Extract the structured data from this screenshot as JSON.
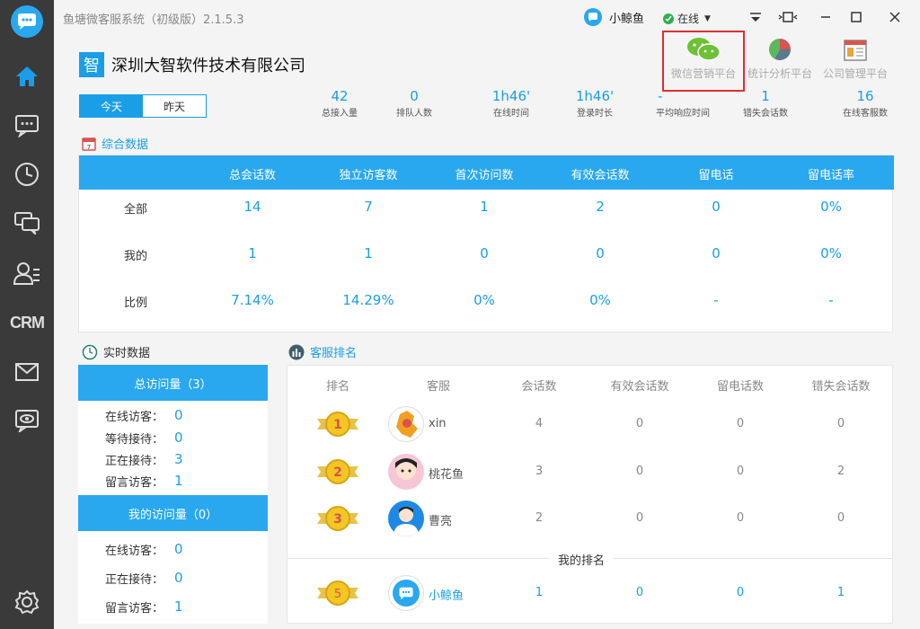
{
  "app": {
    "title": "鱼塘微客服系统（初级版）2.1.5.3",
    "user": "小鲸鱼",
    "status": "在线"
  },
  "sidebar": {
    "items": [
      "home-icon",
      "chat-icon",
      "history-icon",
      "dialog-icon",
      "contacts-icon",
      "CRM",
      "mail-icon",
      "monitor-icon",
      "settings-icon"
    ],
    "crm_label": "CRM"
  },
  "company": {
    "badge": "智",
    "name": "深圳大智软件技术有限公司"
  },
  "platforms": [
    {
      "label": "微信营销平台",
      "icon": "wechat-icon"
    },
    {
      "label": "统计分析平台",
      "icon": "pie-chart-icon"
    },
    {
      "label": "公司管理平台",
      "icon": "company-icon"
    }
  ],
  "day_tabs": [
    "今天",
    "昨天"
  ],
  "stats": [
    {
      "value": "42",
      "label": "总接入量"
    },
    {
      "value": "0",
      "label": "排队人数"
    },
    {
      "value": "1h46'",
      "label": "在线时间"
    },
    {
      "value": "1h46'",
      "label": "登录时长"
    },
    {
      "value": "-",
      "label": "平均响应时间"
    },
    {
      "value": "1",
      "label": "错失会话数"
    },
    {
      "value": "16",
      "label": "在线客服数"
    }
  ],
  "combined": {
    "title": "综合数据",
    "headers": [
      "总会话数",
      "独立访客数",
      "首次访问数",
      "有效会话数",
      "留电话",
      "留电话率"
    ],
    "rows": [
      {
        "label": "全部",
        "values": [
          "14",
          "7",
          "1",
          "2",
          "0",
          "0%"
        ]
      },
      {
        "label": "我的",
        "values": [
          "1",
          "1",
          "0",
          "0",
          "0",
          "0%"
        ]
      },
      {
        "label": "比例",
        "values": [
          "7.14%",
          "14.29%",
          "0%",
          "0%",
          "-",
          "-"
        ]
      }
    ]
  },
  "realtime": {
    "title": "实时数据",
    "total_bar": "总访问量（3）",
    "total_rows": [
      {
        "label": "在线访客：",
        "value": "0"
      },
      {
        "label": "等待接待：",
        "value": "0"
      },
      {
        "label": "正在接待：",
        "value": "3"
      },
      {
        "label": "留言访客：",
        "value": "1"
      }
    ],
    "mine_bar": "我的访问量（0）",
    "mine_rows": [
      {
        "label": "在线访客：",
        "value": "0"
      },
      {
        "label": "正在接待：",
        "value": "0"
      },
      {
        "label": "留言访客：",
        "value": "1"
      }
    ]
  },
  "ranking": {
    "title": "客服排名",
    "headers": [
      "排名",
      "客服",
      "会话数",
      "有效会话数",
      "留电话数",
      "错失会话数"
    ],
    "rows": [
      {
        "rank": "1",
        "name": "xin",
        "values": [
          "4",
          "0",
          "0",
          "0"
        ]
      },
      {
        "rank": "2",
        "name": "桃花鱼",
        "values": [
          "3",
          "0",
          "0",
          "2"
        ]
      },
      {
        "rank": "3",
        "name": "曹亮",
        "values": [
          "2",
          "0",
          "0",
          "0"
        ]
      }
    ],
    "my_rank_label": "我的排名",
    "mine": {
      "rank": "5",
      "name": "小鲸鱼",
      "values": [
        "1",
        "0",
        "0",
        "1"
      ]
    }
  },
  "colors": {
    "accent": "#29a8f0",
    "sidebar": "#3a3a3a",
    "highlight": "#e02e2e"
  }
}
